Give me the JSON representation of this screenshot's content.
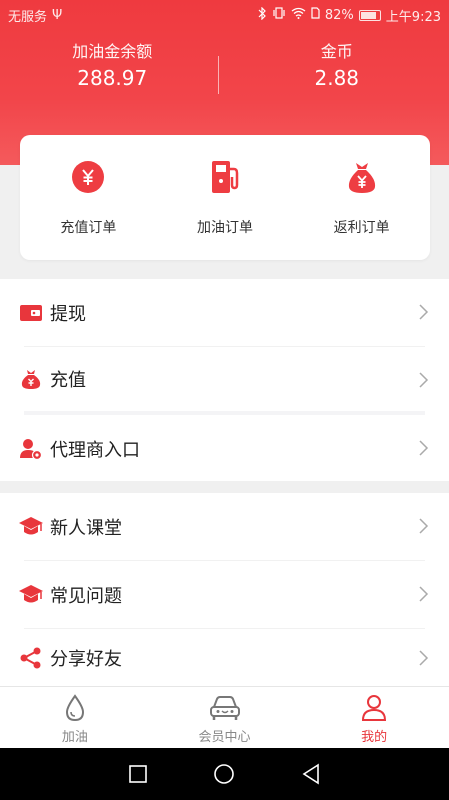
{
  "status_bar": {
    "carrier": "无服务",
    "usb": "Ψ",
    "battery_percent": "82%",
    "time": "上午9:23"
  },
  "summary": {
    "balance_label": "加油金余额",
    "balance_value": "288.97",
    "coins_label": "金币",
    "coins_value": "2.88"
  },
  "orders": [
    {
      "label": "充值订单",
      "icon": "yen-coin-icon"
    },
    {
      "label": "加油订单",
      "icon": "fuel-pump-icon"
    },
    {
      "label": "返利订单",
      "icon": "money-bag-icon"
    }
  ],
  "menu_group_1": [
    {
      "label": "提现",
      "icon": "wallet-icon"
    },
    {
      "label": "充值",
      "icon": "money-bag-icon"
    },
    {
      "label": "代理商入口",
      "icon": "agent-user-icon"
    }
  ],
  "menu_group_2": [
    {
      "label": "新人课堂",
      "icon": "graduation-cap-icon"
    },
    {
      "label": "常见问题",
      "icon": "graduation-cap-icon"
    },
    {
      "label": "分享好友",
      "icon": "share-icon"
    }
  ],
  "tabbar": {
    "items": [
      {
        "label": "加油",
        "icon": "fuel-drop-icon",
        "active": false
      },
      {
        "label": "会员中心",
        "icon": "car-icon",
        "active": false
      },
      {
        "label": "我的",
        "icon": "user-icon",
        "active": true
      }
    ]
  },
  "colors": {
    "brand_red": "#e8363c",
    "header_gradient_top": "#ef3a3f",
    "tab_inactive": "#888888"
  }
}
